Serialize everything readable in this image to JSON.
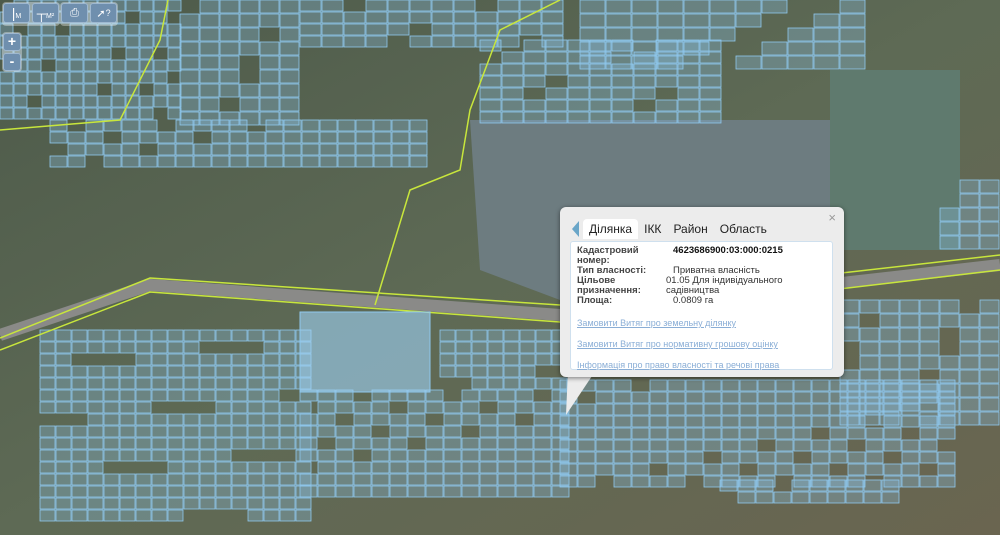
{
  "toolbar": {
    "measure_length": "М",
    "measure_area": "М²",
    "print_icon": "printer-icon",
    "identify_icon": "cursor-question-icon",
    "identify_label": "?"
  },
  "zoom": {
    "in": "+",
    "out": "-"
  },
  "popup": {
    "close": "×",
    "tabs": [
      "Ділянка",
      "ІКК",
      "Район",
      "Область"
    ],
    "active_tab": 0,
    "fields": [
      {
        "label": "Кадастровий номер:",
        "value": "4623686900:03:000:0215"
      },
      {
        "label": "Тип власності:",
        "value": "Приватна власність"
      },
      {
        "label": "Цільове призначення:",
        "value": "01.05 Для індивідуального садівництва"
      },
      {
        "label": "Площа:",
        "value": "0.0809 га"
      }
    ],
    "links": [
      "Замовити Витяг про земельну ділянку",
      "Замовити Витяг про нормативну грошову оцінку",
      "Інформація про право власності та речові права"
    ]
  },
  "colors": {
    "parcel": "#8fc8ee",
    "boundary": "#c8e63c",
    "link": "#8aaed6"
  }
}
